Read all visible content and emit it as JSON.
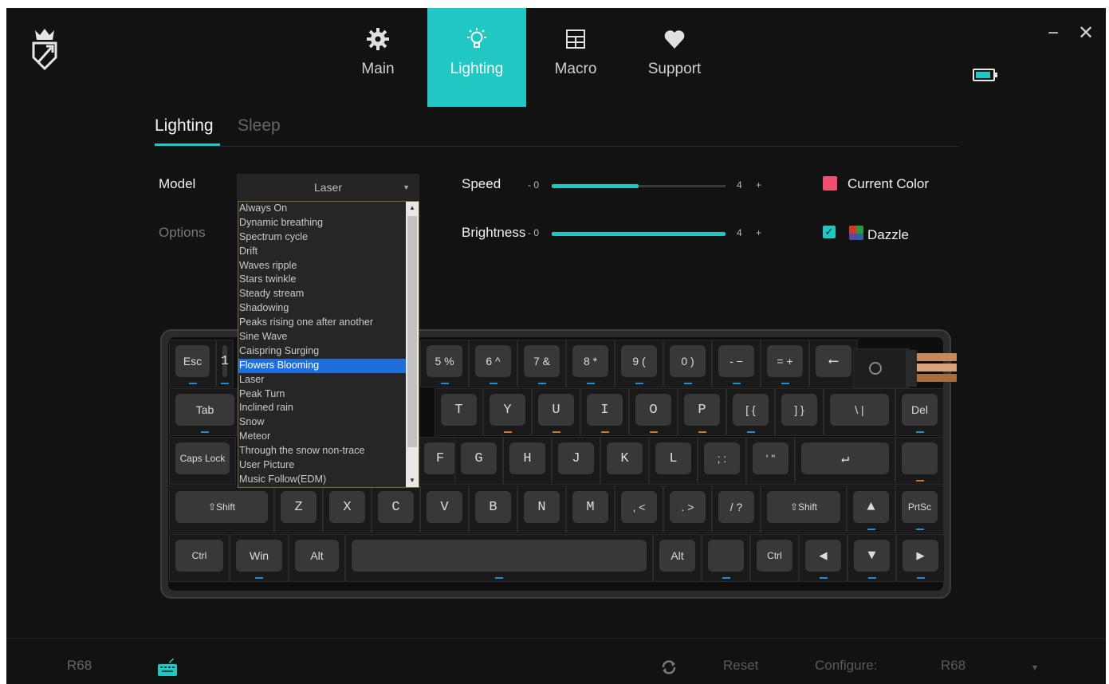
{
  "nav": {
    "tabs": [
      {
        "label": "Main",
        "icon": "gear-icon"
      },
      {
        "label": "Lighting",
        "icon": "lightbulb-icon"
      },
      {
        "label": "Macro",
        "icon": "table-icon"
      },
      {
        "label": "Support",
        "icon": "heart-icon"
      }
    ],
    "active_tab": "Lighting",
    "accent": "#21c7c2"
  },
  "window": {
    "minimize": "−",
    "close": "✕"
  },
  "subtabs": {
    "lighting": "Lighting",
    "sleep": "Sleep"
  },
  "settings": {
    "model_label": "Model",
    "options_label": "Options",
    "model_value": "Laser",
    "speed": {
      "label": "Speed",
      "minus": "- 0",
      "value_text": "4",
      "plus": "+",
      "value": 2,
      "max": 4
    },
    "brightness": {
      "label": "Brightness",
      "minus": "- 0",
      "value_text": "4",
      "plus": "+",
      "value": 4,
      "max": 4
    },
    "current_color_label": "Current Color",
    "current_color": "#f0506e",
    "dazzle_label": "Dazzle",
    "dazzle_checked": true
  },
  "dropdown": {
    "items": [
      "Always On",
      "Dynamic breathing",
      "Spectrum cycle",
      "Drift",
      "Waves ripple",
      "Stars twinkle",
      "Steady stream",
      "Shadowing",
      "Peaks rising one after another",
      "Sine Wave",
      "Caispring Surging",
      "Flowers Blooming",
      "Laser",
      "Peak Turn",
      "Inclined rain",
      "Snow",
      "Meteor",
      "Through the snow non-trace",
      "User Picture",
      "Music Follow(EDM)"
    ],
    "highlighted": "Flowers Blooming"
  },
  "keyboard": {
    "row1": [
      "Esc",
      "1",
      "5 %",
      "6 ^",
      "7 &",
      "8 *",
      "9 (",
      "0 )",
      "- −",
      "= +",
      "⟵"
    ],
    "row2": [
      "Tab",
      "T",
      "Y",
      "U",
      "I",
      "O",
      "P",
      "[ {",
      "] }",
      "\\ |",
      "Del"
    ],
    "row3": [
      "Caps Lock",
      "F",
      "G",
      "H",
      "J",
      "K",
      "L",
      "; :",
      "' \"",
      "↵",
      ""
    ],
    "row4": [
      "⇧Shift",
      "Z",
      "X",
      "C",
      "V",
      "B",
      "N",
      "M",
      ", <",
      ". >",
      "/ ?",
      "⇧Shift",
      "▲",
      "PrtSc"
    ],
    "row5": [
      "Ctrl",
      "Win",
      "Alt",
      "",
      "Alt",
      "",
      "Ctrl",
      "◀",
      "▼",
      "▶"
    ]
  },
  "footer": {
    "device": "R68",
    "reset": "Reset",
    "configure": "Configure:",
    "config_value": "R68",
    "caret": "▾"
  }
}
